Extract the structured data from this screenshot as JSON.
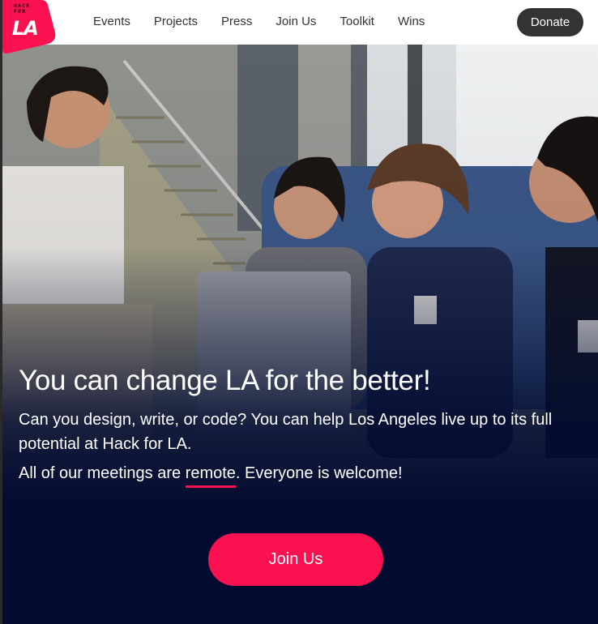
{
  "header": {
    "logo": {
      "line1": "HACK",
      "line2": "FOR",
      "big": "LA",
      "color": "#fa114f"
    },
    "nav": [
      {
        "label": "Events"
      },
      {
        "label": "Projects"
      },
      {
        "label": "Press"
      },
      {
        "label": "Join Us"
      },
      {
        "label": "Toolkit"
      },
      {
        "label": "Wins"
      }
    ],
    "donate_label": "Donate"
  },
  "hero": {
    "image_alt": "group-of-volunteers-photo",
    "headline": "You can change LA for the better!",
    "subtitle": "Can you design, write, or code? You can help Los Angeles live up to its full potential at Hack for LA.",
    "meetings_prefix": "All of our meetings are ",
    "meetings_highlight": "remote",
    "meetings_suffix": ". Everyone is welcome!",
    "cta_label": "Join Us"
  },
  "colors": {
    "accent": "#fa114f",
    "navy": "#030c30",
    "donate_bg": "#333333"
  }
}
